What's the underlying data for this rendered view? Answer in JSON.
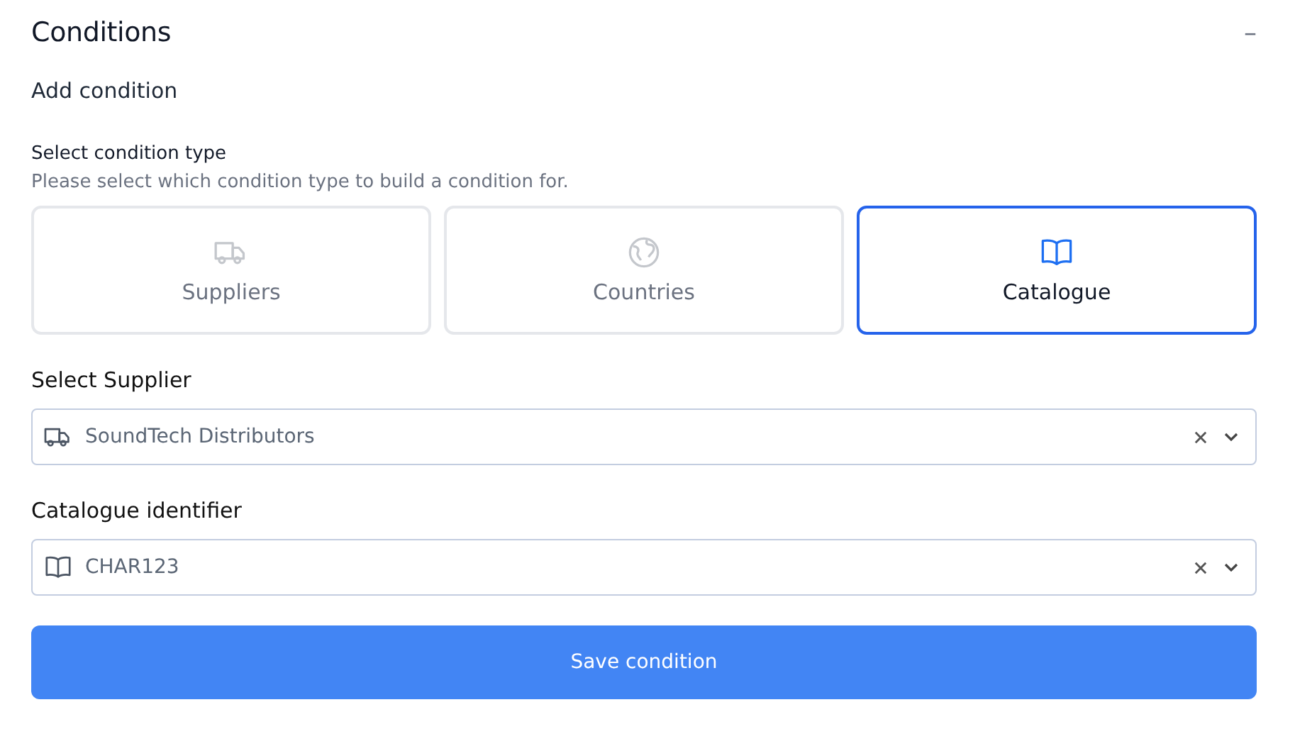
{
  "section": {
    "title": "Conditions",
    "collapse_icon": "–"
  },
  "subtitle": "Add condition",
  "type_picker": {
    "label": "Select condition type",
    "hint": "Please select which condition type to build a condition for.",
    "options": [
      {
        "label": "Suppliers",
        "kind": "truck",
        "selected": false
      },
      {
        "label": "Countries",
        "kind": "globe",
        "selected": false
      },
      {
        "label": "Catalogue",
        "kind": "book",
        "selected": true
      }
    ]
  },
  "fields": [
    {
      "label": "Select Supplier",
      "kind": "truck",
      "value": "SoundTech Distributors"
    },
    {
      "label": "Catalogue identifier",
      "kind": "book",
      "value": "CHAR123"
    }
  ],
  "submit": "Save condition"
}
